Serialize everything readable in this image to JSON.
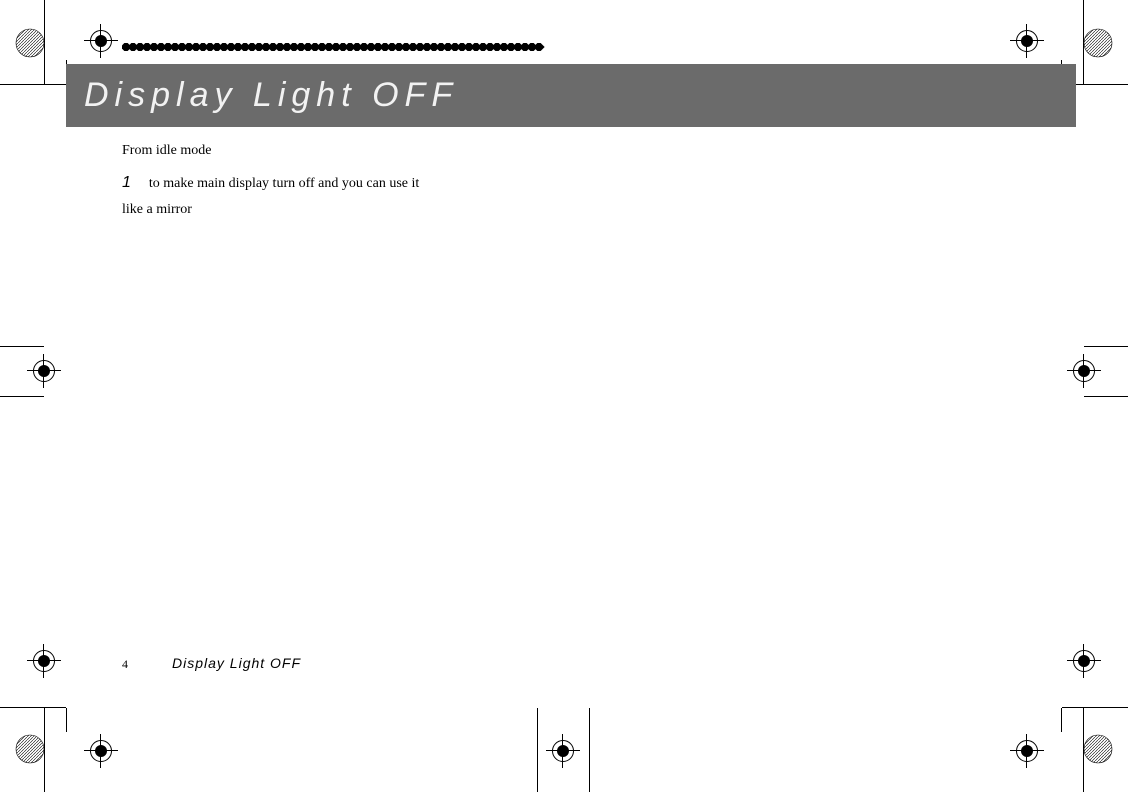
{
  "header": {
    "title": "Display Light OFF"
  },
  "body": {
    "intro": "From idle mode",
    "stepnum": "1",
    "steptext": "to make main display turn off and you can use it",
    "cont": "like a mirror"
  },
  "footer": {
    "page": "4",
    "section": "Display Light OFF"
  }
}
